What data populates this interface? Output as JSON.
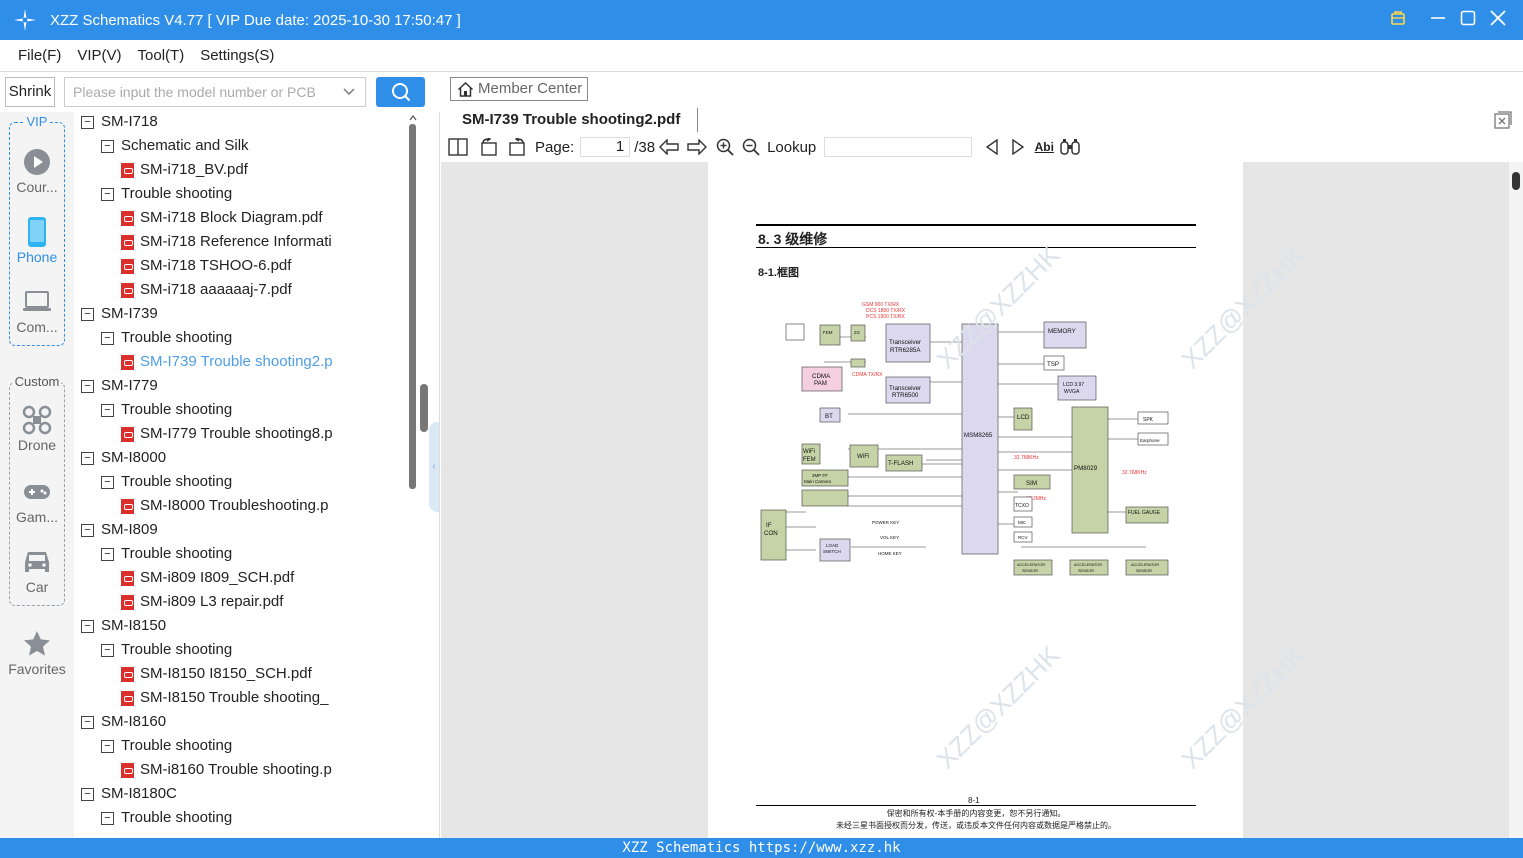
{
  "window": {
    "title": "XZZ Schematics V4.77 [ VIP Due date: 2025-10-30 17:50:47 ]"
  },
  "menu": [
    "File(F)",
    "VIP(V)",
    "Tool(T)",
    "Settings(S)"
  ],
  "search": {
    "shrink_label": "Shrink",
    "placeholder": "Please input the model number or PCB"
  },
  "nav": {
    "vip_label": "VIP",
    "custom_label": "Custom",
    "vip_items": [
      "Cour...",
      "Phone",
      "Com..."
    ],
    "custom_items": [
      "Drone",
      "Gam...",
      "Car"
    ],
    "favorites": "Favorites"
  },
  "tree": [
    {
      "level": 0,
      "label": "SM-I718",
      "type": "folder"
    },
    {
      "level": 1,
      "label": "Schematic and Silk",
      "type": "folder"
    },
    {
      "level": 2,
      "label": "SM-i718_BV.pdf",
      "type": "pdf"
    },
    {
      "level": 1,
      "label": "Trouble shooting",
      "type": "folder"
    },
    {
      "level": 2,
      "label": "SM-i718 Block Diagram.pdf",
      "type": "pdf"
    },
    {
      "level": 2,
      "label": "SM-i718 Reference Informati",
      "type": "pdf"
    },
    {
      "level": 2,
      "label": "SM-i718 TSHOO-6.pdf",
      "type": "pdf"
    },
    {
      "level": 2,
      "label": "SM-i718 aaaaaaj-7.pdf",
      "type": "pdf"
    },
    {
      "level": 0,
      "label": "SM-I739",
      "type": "folder"
    },
    {
      "level": 1,
      "label": "Trouble shooting",
      "type": "folder"
    },
    {
      "level": 2,
      "label": "SM-I739 Trouble shooting2.p",
      "type": "pdf",
      "selected": true
    },
    {
      "level": 0,
      "label": "SM-I779",
      "type": "folder"
    },
    {
      "level": 1,
      "label": "Trouble shooting",
      "type": "folder"
    },
    {
      "level": 2,
      "label": "SM-I779 Trouble shooting8.p",
      "type": "pdf"
    },
    {
      "level": 0,
      "label": "SM-I8000",
      "type": "folder"
    },
    {
      "level": 1,
      "label": "Trouble shooting",
      "type": "folder"
    },
    {
      "level": 2,
      "label": "SM-I8000 Troubleshooting.p",
      "type": "pdf"
    },
    {
      "level": 0,
      "label": "SM-I809",
      "type": "folder"
    },
    {
      "level": 1,
      "label": "Trouble shooting",
      "type": "folder"
    },
    {
      "level": 2,
      "label": "SM-i809 I809_SCH.pdf",
      "type": "pdf"
    },
    {
      "level": 2,
      "label": "SM-i809 L3 repair.pdf",
      "type": "pdf"
    },
    {
      "level": 0,
      "label": "SM-I8150",
      "type": "folder"
    },
    {
      "level": 1,
      "label": "Trouble shooting",
      "type": "folder"
    },
    {
      "level": 2,
      "label": "SM-I8150 I8150_SCH.pdf",
      "type": "pdf"
    },
    {
      "level": 2,
      "label": "SM-I8150 Trouble shooting_",
      "type": "pdf"
    },
    {
      "level": 0,
      "label": "SM-I8160",
      "type": "folder"
    },
    {
      "level": 1,
      "label": "Trouble shooting",
      "type": "folder"
    },
    {
      "level": 2,
      "label": "SM-i8160 Trouble shooting.p",
      "type": "pdf"
    },
    {
      "level": 0,
      "label": "SM-I8180C",
      "type": "folder"
    },
    {
      "level": 1,
      "label": "Trouble shooting",
      "type": "folder"
    }
  ],
  "member_center": "Member Center",
  "doc_tab": "SM-I739 Trouble shooting2.pdf",
  "toolbar": {
    "page_label": "Page:",
    "page_value": "1",
    "page_total": "/38",
    "lookup_label": "Lookup",
    "abi": "Abi"
  },
  "document": {
    "section_title": "8. 3 级维修",
    "subsection": "8-1.框图",
    "page_footer": "8-1",
    "footer_note1": "保密和所有权-本手册的内容变更，恕不另行通知。",
    "footer_note2": "未经三星书面授权而分发，传送，或违反本文件任何内容或数据是严格禁止的。",
    "watermark": "XZZ@XZZHK",
    "blocks": [
      "Transceiver RTR6285A",
      "Transceiver RTR6500",
      "MSM8265",
      "PM8029",
      "MEMORY",
      "CDMA PAM",
      "BT",
      "WiFi FEM",
      "WiFi",
      "T-FLASH",
      "SIM",
      "LCD",
      "TSP",
      "TCXO",
      "MIC",
      "RCV",
      "SPK",
      "Earphone",
      "FUEL GAUGE",
      "ACCELERATOR SENSOR",
      "IF CON",
      "LOAD SWITCH",
      "3MP FF Main Camera",
      "GSM 900 TX/RX",
      "DCS 1800 TX/RX",
      "PCS 1900 TX/RX",
      "CDMA TX/RX",
      "POWER KEY",
      "VOL KEY",
      "HOME KEY",
      "LCD 3.97 WVGA"
    ]
  },
  "status_bar": "XZZ Schematics https://www.xzz.hk",
  "colors": {
    "accent": "#2f8fe8",
    "selected_text": "#4d9de8",
    "pdf_icon": "#d9302c",
    "block_green": "#c5d3a6",
    "block_lilac": "#dcd8ee",
    "block_pink": "#f4cfe0"
  }
}
